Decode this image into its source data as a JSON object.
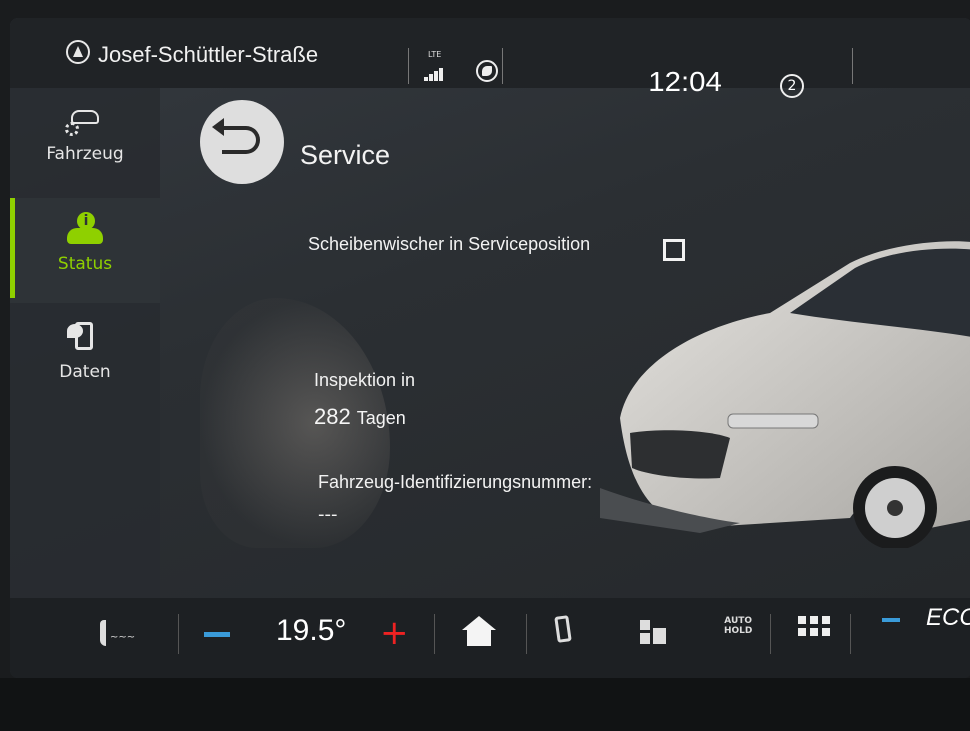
{
  "topbar": {
    "street": "Josef-Schüttler-Straße",
    "network": "LTE",
    "time": "12:04",
    "notification_count": "2"
  },
  "sidebar": {
    "items": [
      {
        "label": "Fahrzeug",
        "icon": "car-settings-icon"
      },
      {
        "label": "Status",
        "icon": "car-info-icon"
      },
      {
        "label": "Daten",
        "icon": "data-fuel-icon"
      }
    ],
    "active_index": 1,
    "accent_color": "#8fd000"
  },
  "main": {
    "title": "Service",
    "wiper": {
      "label": "Scheibenwischer in Serviceposition",
      "checked": false
    },
    "inspection": {
      "label": "Inspektion in",
      "value": "282",
      "unit": "Tagen"
    },
    "vin": {
      "label": "Fahrzeug-Identifizierungsnummer:",
      "value": "---"
    }
  },
  "bottombar": {
    "temperature": "19.5°",
    "minus": "−",
    "plus": "+",
    "autohold_line1": "AUTO",
    "autohold_line2": "HOLD",
    "mode": "ECO"
  }
}
